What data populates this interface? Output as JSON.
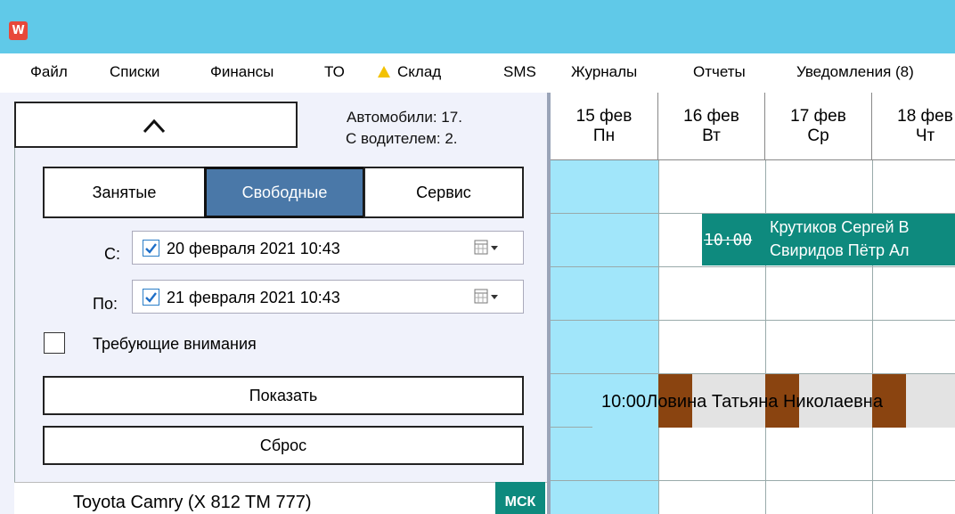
{
  "menu": [
    {
      "label": "Файл"
    },
    {
      "label": "Списки"
    },
    {
      "label": "Финансы"
    },
    {
      "label": "ТО"
    },
    {
      "label": "Склад",
      "warning": true
    },
    {
      "label": "SMS"
    },
    {
      "label": "Журналы"
    },
    {
      "label": "Отчеты"
    },
    {
      "label": "Уведомления (8)"
    }
  ],
  "summary": {
    "cars": "Автомобили: 17.",
    "with_driver": "С водителем: 2."
  },
  "filter": {
    "tabs": [
      {
        "label": "Занятые",
        "active": false
      },
      {
        "label": "Свободные",
        "active": true
      },
      {
        "label": "Сервис",
        "active": false
      }
    ],
    "from_label": "С:",
    "from_value": "20 февраля  2021 10:43",
    "from_checked": true,
    "to_label": "По:",
    "to_value": "21 февраля  2021 10:43",
    "to_checked": true,
    "attention_label": "Требующие внимания",
    "attention_checked": false,
    "show_button": "Показать",
    "reset_button": "Сброс"
  },
  "car": {
    "name": "Toyota Camry (X 812 TM 777)",
    "badge": "МСК"
  },
  "calendar": {
    "days": [
      {
        "date": "15 фев",
        "weekday": "Пн"
      },
      {
        "date": "16 фев",
        "weekday": "Вт"
      },
      {
        "date": "17 фев",
        "weekday": "Ср"
      },
      {
        "date": "18 фев",
        "weekday": "Чт"
      }
    ],
    "booking1": {
      "time": "10:00",
      "line1": "Крутиков Сергей В",
      "line2": "Свиридов Пётр Ал"
    },
    "booking2": {
      "time": "10:00",
      "name": "Ловина Татьяна Николаевна"
    }
  },
  "colors": {
    "titlebar": "#60c9e8",
    "accent_active": "#4a78a8",
    "teal": "#0e8a7e",
    "today_col": "#a1e6fa",
    "brown": "#8a4410"
  }
}
